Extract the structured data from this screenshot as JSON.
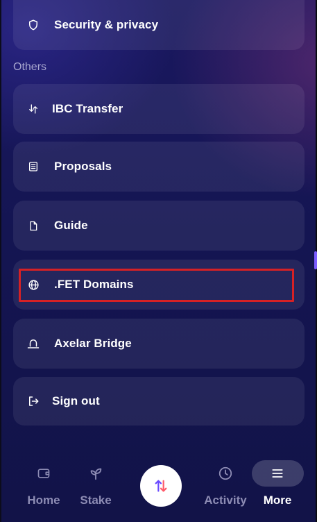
{
  "menu": {
    "top_item": {
      "label": "Security & privacy",
      "icon": "shield-icon"
    },
    "section_title": "Others",
    "items": [
      {
        "label": "IBC Transfer",
        "icon": "transfer-arrows-icon"
      },
      {
        "label": "Proposals",
        "icon": "list-document-icon"
      },
      {
        "label": "Guide",
        "icon": "document-icon"
      },
      {
        "label": ".FET Domains",
        "icon": "globe-icon"
      },
      {
        "label": "Axelar Bridge",
        "icon": "bridge-icon"
      },
      {
        "label": "Sign out",
        "icon": "sign-out-icon"
      }
    ]
  },
  "nav": {
    "items": [
      {
        "label": "Home",
        "icon": "wallet-icon",
        "active": false
      },
      {
        "label": "Stake",
        "icon": "sprout-icon",
        "active": false
      },
      {
        "label": "Activity",
        "icon": "clock-icon",
        "active": false
      },
      {
        "label": "More",
        "icon": "hamburger-menu-icon",
        "active": true
      }
    ],
    "center_button": {
      "icon": "swap-arrows-icon"
    }
  },
  "colors": {
    "background": "#14134a",
    "card": "#ffffff13",
    "highlight_border": "#d52125",
    "muted_text": "#a7a6cf",
    "inactive_nav_label": "#8d8cb4",
    "swap_arrow_up": "#6b4cff",
    "swap_arrow_down": "#ff5a6a"
  }
}
